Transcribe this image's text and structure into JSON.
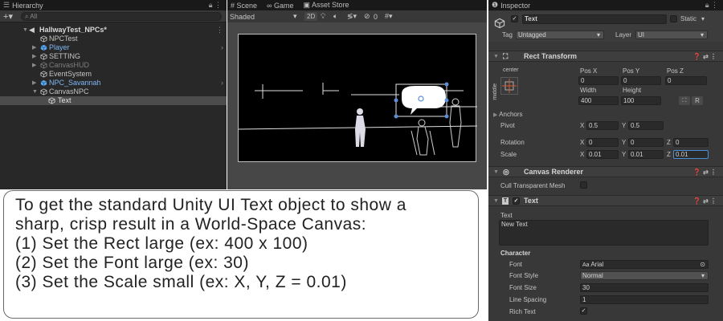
{
  "hierarchy": {
    "tab_label": "Hierarchy",
    "add_label": "+",
    "search_placeholder": "All",
    "scene_name": "HallwayTest_NPCs*",
    "items": [
      {
        "label": "NPCTest",
        "style": "normal"
      },
      {
        "label": "Player",
        "style": "blue"
      },
      {
        "label": "SETTING",
        "style": "normal"
      },
      {
        "label": "CanvasHUD",
        "style": "dim"
      },
      {
        "label": "EventSystem",
        "style": "normal"
      },
      {
        "label": "NPC_Savannah",
        "style": "blue"
      },
      {
        "label": "CanvasNPC",
        "style": "normal"
      },
      {
        "label": "Text",
        "style": "normal"
      }
    ]
  },
  "scene": {
    "tabs": [
      "Scene",
      "Game",
      "Asset Store"
    ],
    "shading_mode": "Shaded",
    "btn_2d": "2D",
    "gizmo_count": "0"
  },
  "inspector": {
    "tab_label": "Inspector",
    "object_name": "Text",
    "static_label": "Static",
    "tag_label": "Tag",
    "tag_value": "Untagged",
    "layer_label": "Layer",
    "layer_value": "UI",
    "rect_transform": {
      "title": "Rect Transform",
      "anchor_h": "center",
      "anchor_v": "middle",
      "pos_x_label": "Pos X",
      "pos_x": "0",
      "pos_y_label": "Pos Y",
      "pos_y": "0",
      "pos_z_label": "Pos Z",
      "pos_z": "0",
      "width_label": "Width",
      "width": "400",
      "height_label": "Height",
      "height": "100",
      "r_button": "R",
      "anchors_label": "Anchors",
      "pivot_label": "Pivot",
      "pivot_x": "0.5",
      "pivot_y": "0.5",
      "rotation_label": "Rotation",
      "rot_x": "0",
      "rot_y": "0",
      "rot_z": "0",
      "scale_label": "Scale",
      "scale_x": "0.01",
      "scale_y": "0.01",
      "scale_z": "0.01"
    },
    "canvas_renderer": {
      "title": "Canvas Renderer",
      "cull_label": "Cull Transparent Mesh"
    },
    "text_component": {
      "title": "Text",
      "text_label": "Text",
      "text_value": "New Text",
      "character_label": "Character",
      "font_label": "Font",
      "font_value": "Arial",
      "font_style_label": "Font Style",
      "font_style_value": "Normal",
      "font_size_label": "Font Size",
      "font_size_value": "30",
      "line_spacing_label": "Line Spacing",
      "line_spacing_value": "1",
      "rich_text_label": "Rich Text"
    }
  },
  "caption": {
    "lines": [
      "To get the standard Unity UI Text object to show a",
      "sharp, crisp result in a World-Space Canvas:",
      "(1) Set the Rect large (ex: 400 x 100)",
      "(2) Set the Font large (ex: 30)",
      "(3) Set the Scale small (ex: X, Y, Z = 0.01)"
    ]
  },
  "colors": {
    "accent_blue": "#7fb6f5",
    "panel_bg": "#383838",
    "dark_bg": "#282828"
  }
}
